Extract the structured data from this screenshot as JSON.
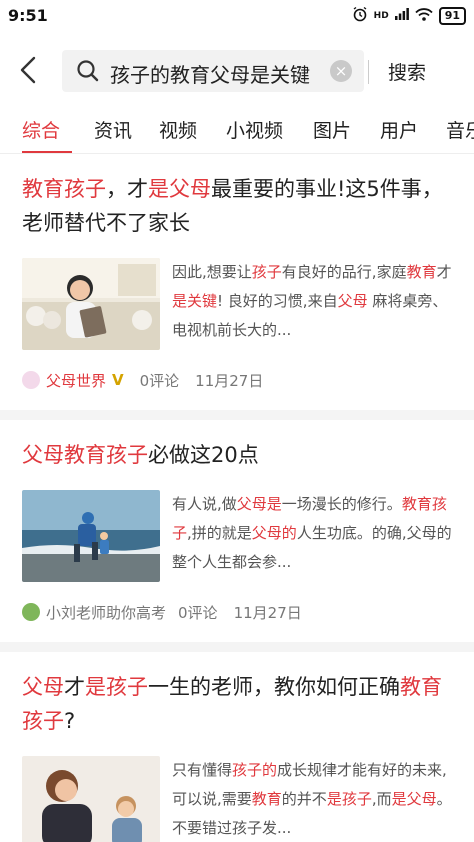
{
  "status": {
    "time": "9:51",
    "network": "HD",
    "battery": "91"
  },
  "search": {
    "query": "孩子的教育父母是关键",
    "button": "搜索"
  },
  "tabs": [
    "综合",
    "资讯",
    "视频",
    "小视频",
    "图片",
    "用户",
    "音乐"
  ],
  "articles": [
    {
      "title": [
        {
          "t": "教育孩子",
          "hl": true
        },
        {
          "t": "，才",
          "hl": false
        },
        {
          "t": "是",
          "hl": true
        },
        {
          "t": "父母",
          "hl": true
        },
        {
          "t": "最重要的事业!这5件事，老师替代不了家长",
          "hl": false
        }
      ],
      "snippet": [
        {
          "t": "因此,想要让",
          "hl": false
        },
        {
          "t": "孩子",
          "hl": true
        },
        {
          "t": "有良好的品行,家庭",
          "hl": false
        },
        {
          "t": "教育",
          "hl": true
        },
        {
          "t": "才",
          "hl": false
        },
        {
          "t": "是关键",
          "hl": true
        },
        {
          "t": "! 良好的习惯,来自",
          "hl": false
        },
        {
          "t": "父母",
          "hl": true
        },
        {
          "t": " 麻将桌旁、电视机前长大的...",
          "hl": false
        }
      ],
      "source": "父母世界",
      "verified": "V",
      "comments": "0评论",
      "date": "11月27日"
    },
    {
      "title": [
        {
          "t": "父母教育孩子",
          "hl": true
        },
        {
          "t": "必做这20点",
          "hl": false
        }
      ],
      "snippet": [
        {
          "t": "有人说,做",
          "hl": false
        },
        {
          "t": "父母是",
          "hl": true
        },
        {
          "t": "一场漫长的修行。",
          "hl": false
        },
        {
          "t": "教育孩子",
          "hl": true
        },
        {
          "t": ",拼的就是",
          "hl": false
        },
        {
          "t": "父母的",
          "hl": true
        },
        {
          "t": "人生功底。的确,父母的整个人生都会参...",
          "hl": false
        }
      ],
      "source": "小刘老师助你高考",
      "comments": "0评论",
      "date": "11月27日"
    },
    {
      "title": [
        {
          "t": "父母",
          "hl": true
        },
        {
          "t": "才",
          "hl": false
        },
        {
          "t": "是孩子",
          "hl": true
        },
        {
          "t": "一生的老师，教你如何正确",
          "hl": false
        },
        {
          "t": "教育孩子",
          "hl": true
        },
        {
          "t": "?",
          "hl": false
        }
      ],
      "snippet": [
        {
          "t": "只有懂得",
          "hl": false
        },
        {
          "t": "孩子的",
          "hl": true
        },
        {
          "t": "成长规律才能有好的未来,可以说,需要",
          "hl": false
        },
        {
          "t": "教育",
          "hl": true
        },
        {
          "t": "的并不",
          "hl": false
        },
        {
          "t": "是",
          "hl": true
        },
        {
          "t": "孩子",
          "hl": true
        },
        {
          "t": ",而",
          "hl": false
        },
        {
          "t": "是父母",
          "hl": true
        },
        {
          "t": "。不要错过孩子发...",
          "hl": false
        }
      ]
    }
  ],
  "colors": {
    "accent": "#e0393e",
    "verified": "#d4a300"
  }
}
